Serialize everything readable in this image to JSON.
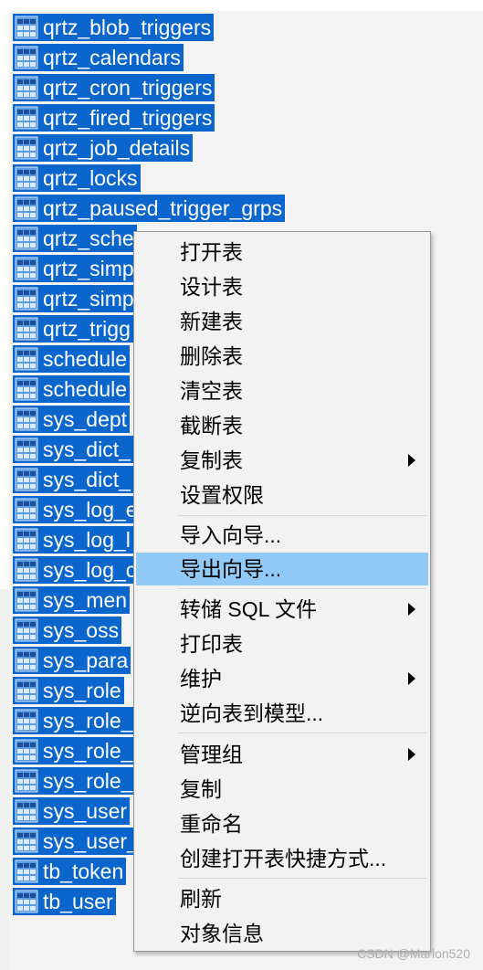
{
  "tables": [
    "qrtz_blob_triggers",
    "qrtz_calendars",
    "qrtz_cron_triggers",
    "qrtz_fired_triggers",
    "qrtz_job_details",
    "qrtz_locks",
    "qrtz_paused_trigger_grps",
    "qrtz_sche",
    "qrtz_simp",
    "qrtz_simp",
    "qrtz_trigg",
    "schedule",
    "schedule",
    "sys_dept",
    "sys_dict_",
    "sys_dict_",
    "sys_log_e",
    "sys_log_l",
    "sys_log_c",
    "sys_men",
    "sys_oss",
    "sys_para",
    "sys_role",
    "sys_role_",
    "sys_role_",
    "sys_role_",
    "sys_user",
    "sys_user_",
    "tb_token",
    "tb_user"
  ],
  "context_menu": {
    "items": [
      {
        "label": "打开表"
      },
      {
        "label": "设计表"
      },
      {
        "label": "新建表"
      },
      {
        "label": "删除表"
      },
      {
        "label": "清空表"
      },
      {
        "label": "截断表"
      },
      {
        "label": "复制表"
      },
      {
        "label": "设置权限"
      },
      {
        "label": "导入向导..."
      },
      {
        "label": "导出向导..."
      },
      {
        "label": "转储 SQL 文件"
      },
      {
        "label": "打印表"
      },
      {
        "label": "维护"
      },
      {
        "label": "逆向表到模型..."
      },
      {
        "label": "管理组"
      },
      {
        "label": "复制"
      },
      {
        "label": "重命名"
      },
      {
        "label": "创建打开表快捷方式..."
      },
      {
        "label": "刷新"
      },
      {
        "label": "对象信息"
      }
    ]
  },
  "watermark": "CSDN @Marlon520",
  "colors": {
    "selection": "#0a66cc",
    "menu_highlight": "#91c9f7",
    "menu_background": "#f2f2f2"
  }
}
